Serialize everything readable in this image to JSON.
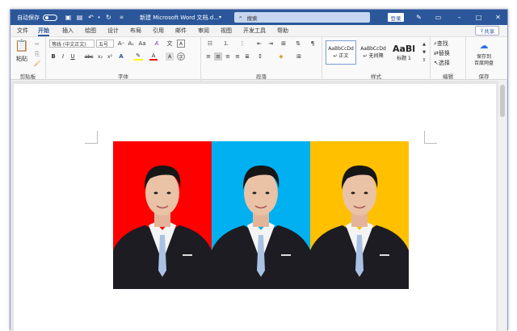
{
  "titlebar": {
    "autosave_label": "自动保存",
    "autosave_state": "关",
    "doc_title": "新建 Microsoft Word 文档.d...",
    "search_placeholder": "搜索",
    "login_label": "登录"
  },
  "tabs": [
    "文件",
    "开始",
    "插入",
    "绘图",
    "设计",
    "布局",
    "引用",
    "邮件",
    "审阅",
    "视图",
    "开发工具",
    "帮助"
  ],
  "share_label": "共享",
  "ribbon": {
    "clipboard": {
      "paste_label": "粘贴",
      "group_label": "剪贴板"
    },
    "font": {
      "font_name": "等线 (中文正文)",
      "font_size": "五号",
      "group_label": "字体",
      "buttons": [
        "B",
        "I",
        "U",
        "abc",
        "x₂",
        "x²",
        "A"
      ]
    },
    "paragraph": {
      "group_label": "段落"
    },
    "styles": {
      "items": [
        {
          "preview": "AaBbCcDd",
          "name": "↵ 正文"
        },
        {
          "preview": "AaBbCcDd",
          "name": "↵ 无间隔"
        },
        {
          "preview": "AaBl",
          "name": "标题 1"
        }
      ],
      "group_label": "样式"
    },
    "editing": {
      "find": "查找",
      "replace": "替换",
      "select": "选择",
      "group_label": "编辑"
    },
    "save": {
      "label_line1": "保存到",
      "label_line2": "百度网盘",
      "group_label": "保存"
    }
  },
  "photos": [
    {
      "background": "#fe0000"
    },
    {
      "background": "#00b0f0"
    },
    {
      "background": "#ffc000"
    }
  ]
}
